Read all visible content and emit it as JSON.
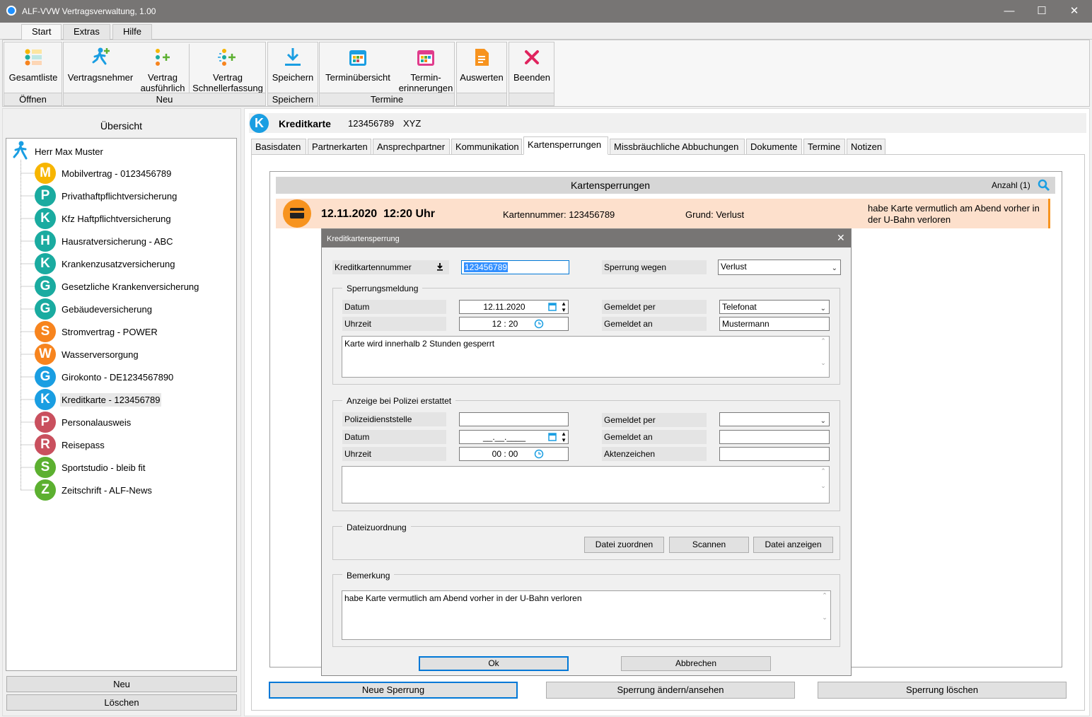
{
  "window": {
    "title": "ALF-VVW Vertragsverwaltung, 1.00"
  },
  "menu_tabs": [
    "Start",
    "Extras",
    "Hilfe"
  ],
  "ribbon": {
    "groups": {
      "oeffnen": "Öffnen",
      "neu": "Neu",
      "speichern": "Speichern",
      "termine": "Termine"
    },
    "buttons": {
      "gesamtliste": "Gesamtliste",
      "vertragsnehmer": "Vertragsnehmer",
      "vertrag_ausf_1": "Vertrag",
      "vertrag_ausf_2": "ausführlich",
      "vertrag_schnell_1": "Vertrag",
      "vertrag_schnell_2": "Schnellerfassung",
      "speichern": "Speichern",
      "terminuebersicht": "Terminübersicht",
      "terminerinnerungen_1": "Termin-",
      "terminerinnerungen_2": "erinnerungen",
      "auswerten": "Auswerten",
      "beenden": "Beenden"
    }
  },
  "sidebar": {
    "title": "Übersicht",
    "root": "Herr Max Muster",
    "items": [
      {
        "letter": "M",
        "label": "Mobilvertrag - 0123456789",
        "color": "#f7b500"
      },
      {
        "letter": "P",
        "label": "Privathaftpflichtversicherung",
        "color": "#1aaba0"
      },
      {
        "letter": "K",
        "label": "Kfz Haftpflichtversicherung",
        "color": "#1aaba0"
      },
      {
        "letter": "H",
        "label": "Hausratversicherung - ABC",
        "color": "#1aaba0"
      },
      {
        "letter": "K",
        "label": "Krankenzusatzversicherung",
        "color": "#1aaba0"
      },
      {
        "letter": "G",
        "label": "Gesetzliche Krankenversicherung",
        "color": "#1aaba0"
      },
      {
        "letter": "G",
        "label": "Gebäudeversicherung",
        "color": "#1aaba0"
      },
      {
        "letter": "S",
        "label": "Stromvertrag - POWER",
        "color": "#f7841e"
      },
      {
        "letter": "W",
        "label": "Wasserversorgung",
        "color": "#f7841e"
      },
      {
        "letter": "G",
        "label": "Girokonto - DE1234567890",
        "color": "#1a9ee2"
      },
      {
        "letter": "K",
        "label": "Kreditkarte - 123456789",
        "color": "#1a9ee2"
      },
      {
        "letter": "P",
        "label": "Personalausweis",
        "color": "#c9505e"
      },
      {
        "letter": "R",
        "label": "Reisepass",
        "color": "#c9505e"
      },
      {
        "letter": "S",
        "label": "Sportstudio - bleib fit",
        "color": "#5cb030"
      },
      {
        "letter": "Z",
        "label": "Zeitschrift - ALF-News",
        "color": "#5cb030"
      }
    ],
    "btn_new": "Neu",
    "btn_delete": "Löschen"
  },
  "header": {
    "letter": "K",
    "title": "Kreditkarte",
    "number": "123456789",
    "extra": "XYZ"
  },
  "tabs": [
    "Basisdaten",
    "Partnerkarten",
    "Ansprechpartner",
    "Kommunikation",
    "Kartensperrungen",
    "Missbräuchliche Abbuchungen",
    "Dokumente",
    "Termine",
    "Notizen"
  ],
  "grid": {
    "title": "Kartensperrungen",
    "count": "Anzahl (1)",
    "row": {
      "datetime": "12.11.2020  12:20 Uhr",
      "cardnumber": "Kartennummer: 123456789",
      "reason": "Grund: Verlust",
      "note": "habe Karte vermutlich am Abend vorher in der U-Bahn verloren"
    }
  },
  "bottom_buttons": {
    "neu": "Neue Sperrung",
    "aendern": "Sperrung ändern/ansehen",
    "loeschen": "Sperrung löschen"
  },
  "dialog": {
    "title": "Kreditkartensperrung",
    "kartennummer_label": "Kreditkartennummer",
    "kartennummer_value": "123456789",
    "sperrung_label": "Sperrung wegen",
    "sperrung_value": "Verlust",
    "meldung": {
      "legend": "Sperrungsmeldung",
      "datum_label": "Datum",
      "datum_value": "12.11.2020",
      "uhrzeit_label": "Uhrzeit",
      "uhrzeit_value": "12 : 20",
      "per_label": "Gemeldet per",
      "per_value": "Telefonat",
      "an_label": "Gemeldet an",
      "an_value": "Mustermann",
      "text": "Karte wird innerhalb 2 Stunden gesperrt"
    },
    "polizei": {
      "legend": "Anzeige bei Polizei erstattet",
      "dienststelle_label": "Polizeidienststelle",
      "datum_label": "Datum",
      "datum_value": "__.__.____",
      "uhrzeit_label": "Uhrzeit",
      "uhrzeit_value": "00 : 00",
      "per_label": "Gemeldet per",
      "an_label": "Gemeldet an",
      "akten_label": "Aktenzeichen"
    },
    "datei": {
      "legend": "Dateizuordnung",
      "zuordnen": "Datei zuordnen",
      "scannen": "Scannen",
      "anzeigen": "Datei anzeigen"
    },
    "bemerkung": {
      "legend": "Bemerkung",
      "text": "habe Karte vermutlich am Abend vorher in der U-Bahn verloren"
    },
    "ok": "Ok",
    "cancel": "Abbrechen"
  }
}
